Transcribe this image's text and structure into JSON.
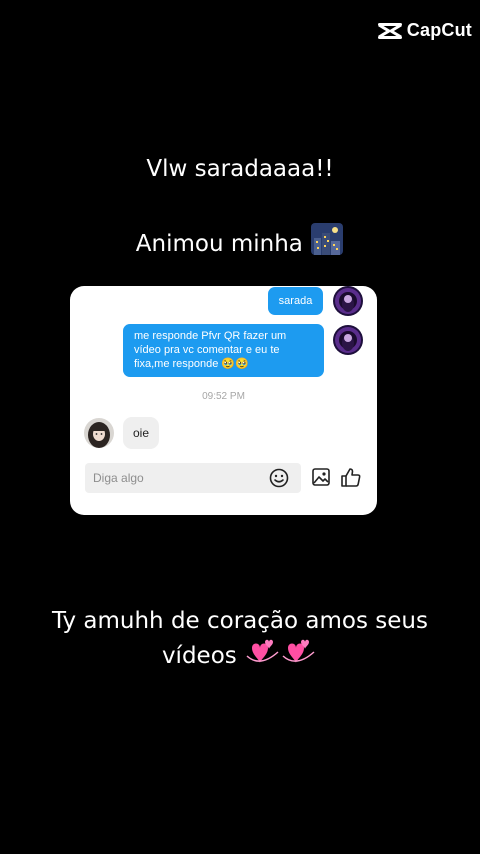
{
  "watermark": {
    "logo_icon": "capcut-logo-icon",
    "text": "CapCut"
  },
  "captions": {
    "line1": "Vlw saradaaaa!!",
    "line2": "Animou minha",
    "line2_emoji": "night-city-emoji",
    "line3": "Ty amuhh de coração amos seus vídeos",
    "line3_emoji": "revolving-hearts-emoji"
  },
  "chat": {
    "messages": [
      {
        "direction": "outgoing",
        "text": "sarada"
      },
      {
        "direction": "outgoing",
        "text": "me responde Pfvr QR fazer um vídeo pra vc comentar e eu te fixa,me responde 🥹🥹"
      },
      {
        "direction": "incoming",
        "text": "oie"
      }
    ],
    "timestamp": "09:52 PM",
    "input": {
      "placeholder": "Diga algo",
      "value": ""
    },
    "icons": {
      "emoji": "emoji-icon",
      "image": "image-icon",
      "like": "thumbs-up-icon"
    }
  },
  "colors": {
    "background": "#000000",
    "outgoing_bubble": "#1d9bf0",
    "incoming_bubble": "#efefef",
    "card": "#ffffff",
    "caption_text": "#ffffff"
  }
}
